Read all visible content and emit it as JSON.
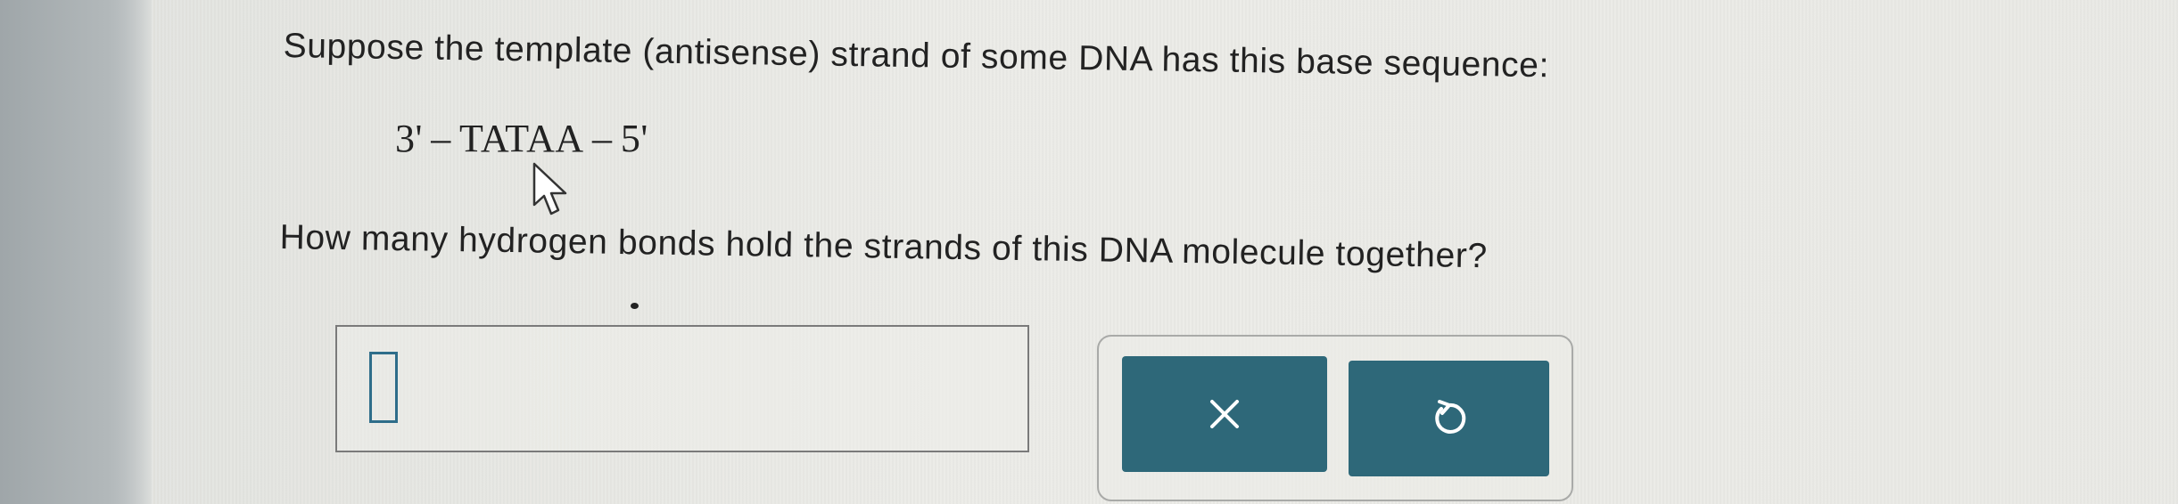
{
  "question": {
    "intro": "Suppose the template (antisense) strand of some DNA has this base sequence:",
    "sequence": "3' – TATAA – 5'",
    "prompt": "How many hydrogen bonds hold the strands of this DNA molecule together?"
  },
  "answer": {
    "value": "",
    "placeholder": ""
  },
  "buttons": {
    "clear_icon": "x-icon",
    "undo_icon": "undo-icon"
  },
  "colors": {
    "button_bg": "#2e6879",
    "input_border": "#2e6d8a",
    "text": "#222222"
  }
}
